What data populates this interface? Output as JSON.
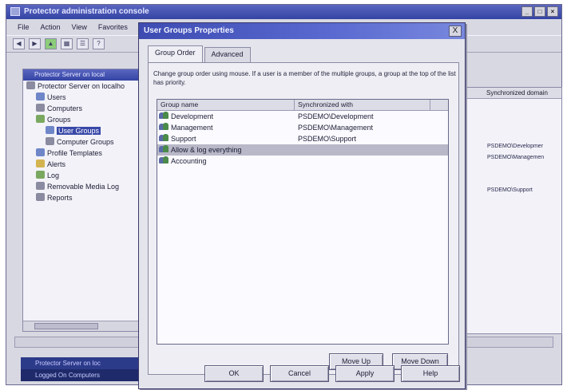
{
  "mmc": {
    "title": "Protector administration console",
    "menu": [
      "File",
      "Action",
      "View",
      "Favorites"
    ],
    "toolbar_icons": [
      "back-icon",
      "forward-icon",
      "up-folder-icon",
      "show-tree-icon",
      "properties-icon",
      "help-icon"
    ],
    "tree_header": "Protector Server on local",
    "tree": [
      {
        "label": "Protector Server on localho",
        "icon": "server-icon",
        "level": 0
      },
      {
        "label": "Users",
        "icon": "users-icon",
        "level": 1
      },
      {
        "label": "Computers",
        "icon": "computers-icon",
        "level": 1
      },
      {
        "label": "Groups",
        "icon": "groups-icon",
        "level": 1
      },
      {
        "label": "User Groups",
        "icon": "user-groups-icon",
        "level": 2,
        "selected": true
      },
      {
        "label": "Computer Groups",
        "icon": "computer-groups-icon",
        "level": 2
      },
      {
        "label": "Profile Templates",
        "icon": "profile-templates-icon",
        "level": 1
      },
      {
        "label": "Alerts",
        "icon": "alerts-icon",
        "level": 1
      },
      {
        "label": "Log",
        "icon": "log-icon",
        "level": 1
      },
      {
        "label": "Removable Media Log",
        "icon": "media-log-icon",
        "level": 1
      },
      {
        "label": "Reports",
        "icon": "reports-icon",
        "level": 1
      }
    ],
    "right_header": "Synchronized domain",
    "right_values": [
      "PSDEMO\\Developmer",
      "PSDEMO\\Managemen",
      "PSDEMO\\Support"
    ],
    "bottom_rows": [
      "Protector Server on loc",
      "Logged On Computers"
    ]
  },
  "dialog": {
    "title": "User Groups Properties",
    "close_glyph": "X",
    "tabs": [
      "Group Order",
      "Advanced"
    ],
    "description": "Change group order using mouse. If a user is a member of the multiple groups, a group at the top of the list has priority.",
    "columns": [
      "Group name",
      "Synchronized with"
    ],
    "rows": [
      {
        "name": "Development",
        "sync": "PSDEMO\\Development"
      },
      {
        "name": "Management",
        "sync": "PSDEMO\\Management"
      },
      {
        "name": "Support",
        "sync": "PSDEMO\\Support"
      },
      {
        "name": "Allow & log everything",
        "sync": "",
        "highlighted": true
      },
      {
        "name": "Accounting",
        "sync": ""
      }
    ],
    "buttons": {
      "move_up": "Move Up",
      "move_down": "Move Down",
      "ok": "OK",
      "cancel": "Cancel",
      "apply": "Apply",
      "help": "Help"
    }
  }
}
